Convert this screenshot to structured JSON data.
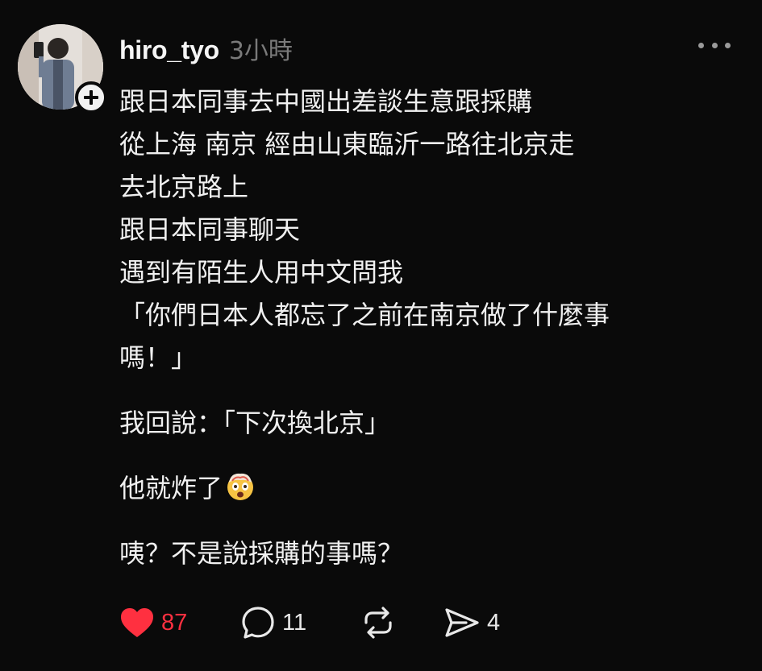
{
  "post": {
    "username": "hiro_tyo",
    "timestamp": "3小時",
    "paragraphs": [
      [
        "跟日本同事去中國出差談生意跟採購",
        "從上海 南京 經由山東臨沂一路往北京走",
        "去北京路上",
        "跟日本同事聊天",
        "遇到有陌生人用中文問我",
        "「你們日本人都忘了之前在南京做了什麼事",
        "嗎！」"
      ],
      [
        "我回說：「下次換北京」"
      ],
      [
        "他就炸了"
      ],
      [
        "咦？不是說採購的事嗎？"
      ]
    ],
    "emoji": "exploding-head-emoji"
  },
  "actions": {
    "likes": "87",
    "comments": "11",
    "shares": "4"
  },
  "colors": {
    "background": "#0a0a0a",
    "like": "#ff3040",
    "muted": "#7a7a7a"
  }
}
